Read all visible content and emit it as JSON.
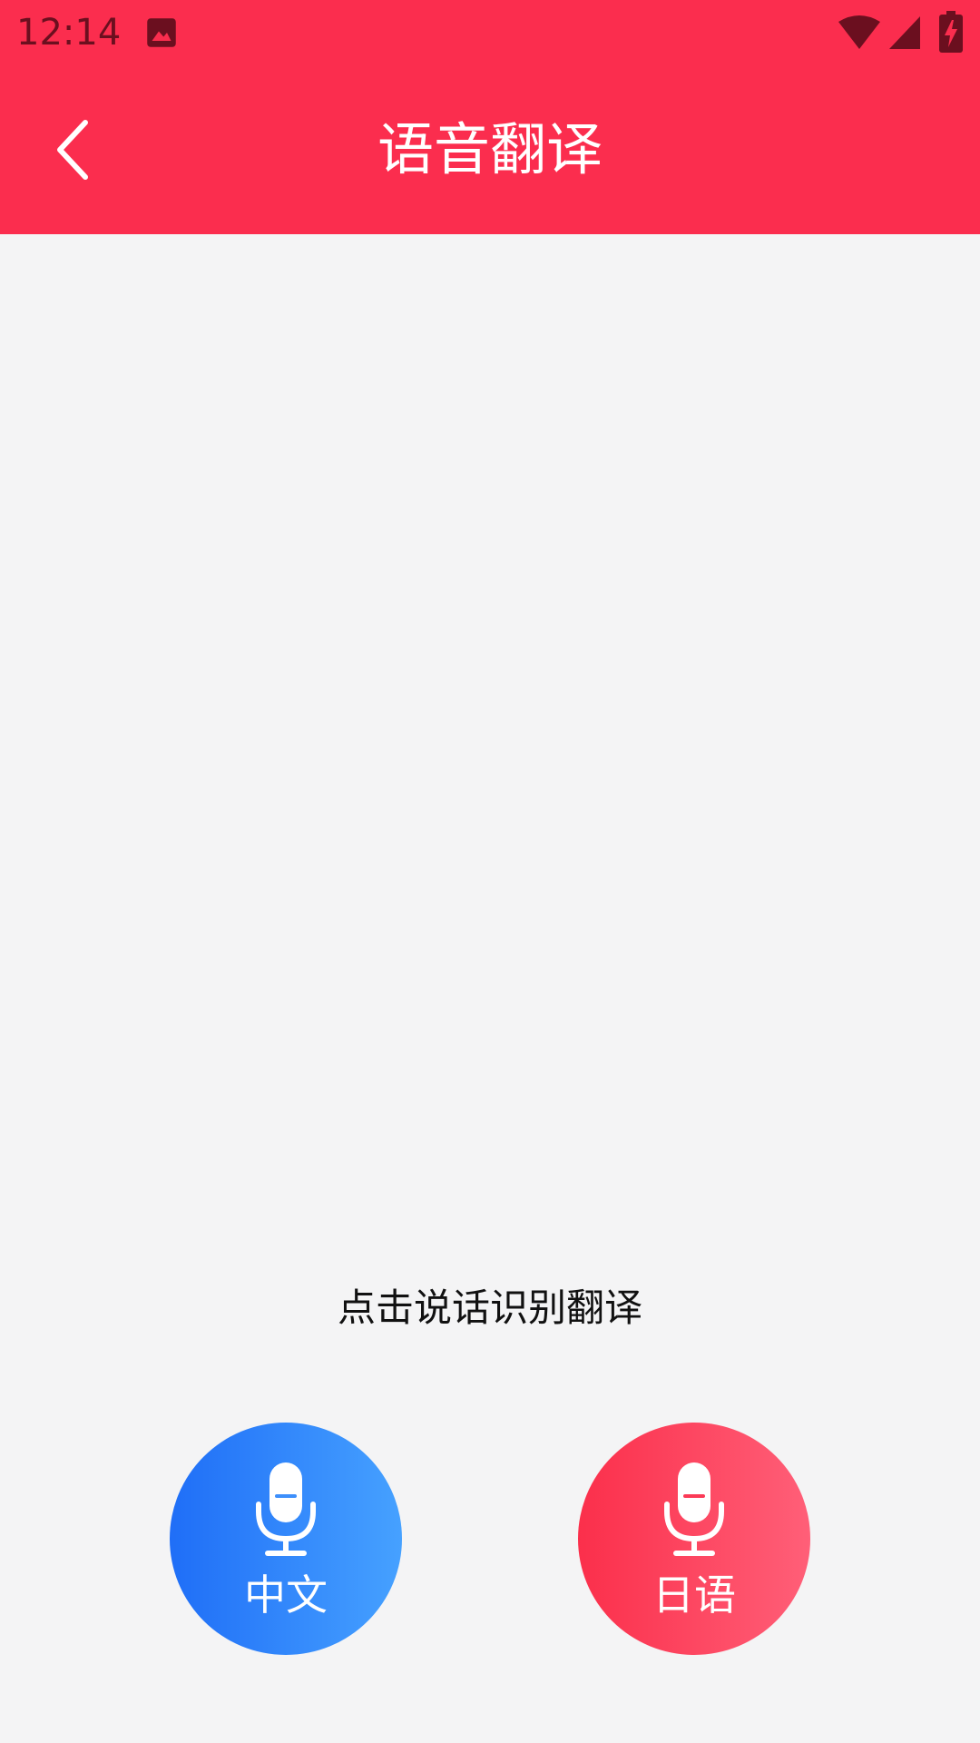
{
  "status_bar": {
    "time": "12:14",
    "icons": [
      "gallery-icon",
      "wifi-icon",
      "cellular-signal-icon",
      "battery-charging-icon"
    ],
    "color": "#6b0f1f"
  },
  "app_bar": {
    "title": "语音翻译",
    "back_icon": "chevron-left-icon",
    "background": "#fb2d4e"
  },
  "main": {
    "hint": "点击说话识别翻译",
    "background": "#f4f4f5"
  },
  "voice_buttons": [
    {
      "label": "中文",
      "icon": "microphone-icon",
      "gradient": [
        "#1f6ef7",
        "#46a1ff"
      ]
    },
    {
      "label": "日语",
      "icon": "microphone-icon",
      "gradient": [
        "#fb2f4b",
        "#ff5f78"
      ]
    }
  ]
}
